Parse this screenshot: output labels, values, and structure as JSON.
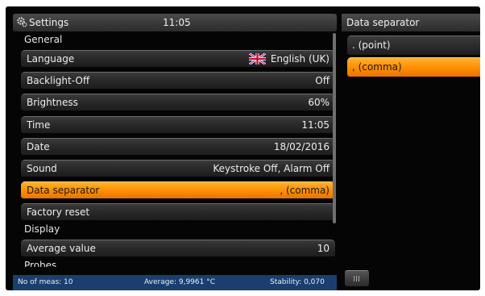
{
  "header": {
    "title": "Settings",
    "time": "11:05",
    "icon": "gear-icon"
  },
  "settings": {
    "general_label": "General",
    "language": {
      "label": "Language",
      "value": "English (UK)"
    },
    "backlight": {
      "label": "Backlight-Off",
      "value": "Off"
    },
    "brightness": {
      "label": "Brightness",
      "value": "60%"
    },
    "time": {
      "label": "Time",
      "value": "11:05"
    },
    "date": {
      "label": "Date",
      "value": "18/02/2016"
    },
    "sound": {
      "label": "Sound",
      "value": "Keystroke Off, Alarm Off"
    },
    "separator": {
      "label": "Data separator",
      "value": ", (comma)"
    },
    "factory_reset": {
      "label": "Factory reset"
    },
    "display_label": "Display",
    "average": {
      "label": "Average value",
      "value": "10"
    },
    "probes_label": "Probes"
  },
  "separator_panel": {
    "title": "Data separator",
    "options": [
      ". (point)",
      ", (comma)"
    ],
    "selected": ", (comma)"
  },
  "status": {
    "meas": "No of meas: 10",
    "average": "Average: 9,9961 °C",
    "stability": "Stability: 0,070"
  },
  "colors": {
    "accent": "#ff8c00",
    "status_bg": "#1a3f6e",
    "background": "#050505"
  }
}
